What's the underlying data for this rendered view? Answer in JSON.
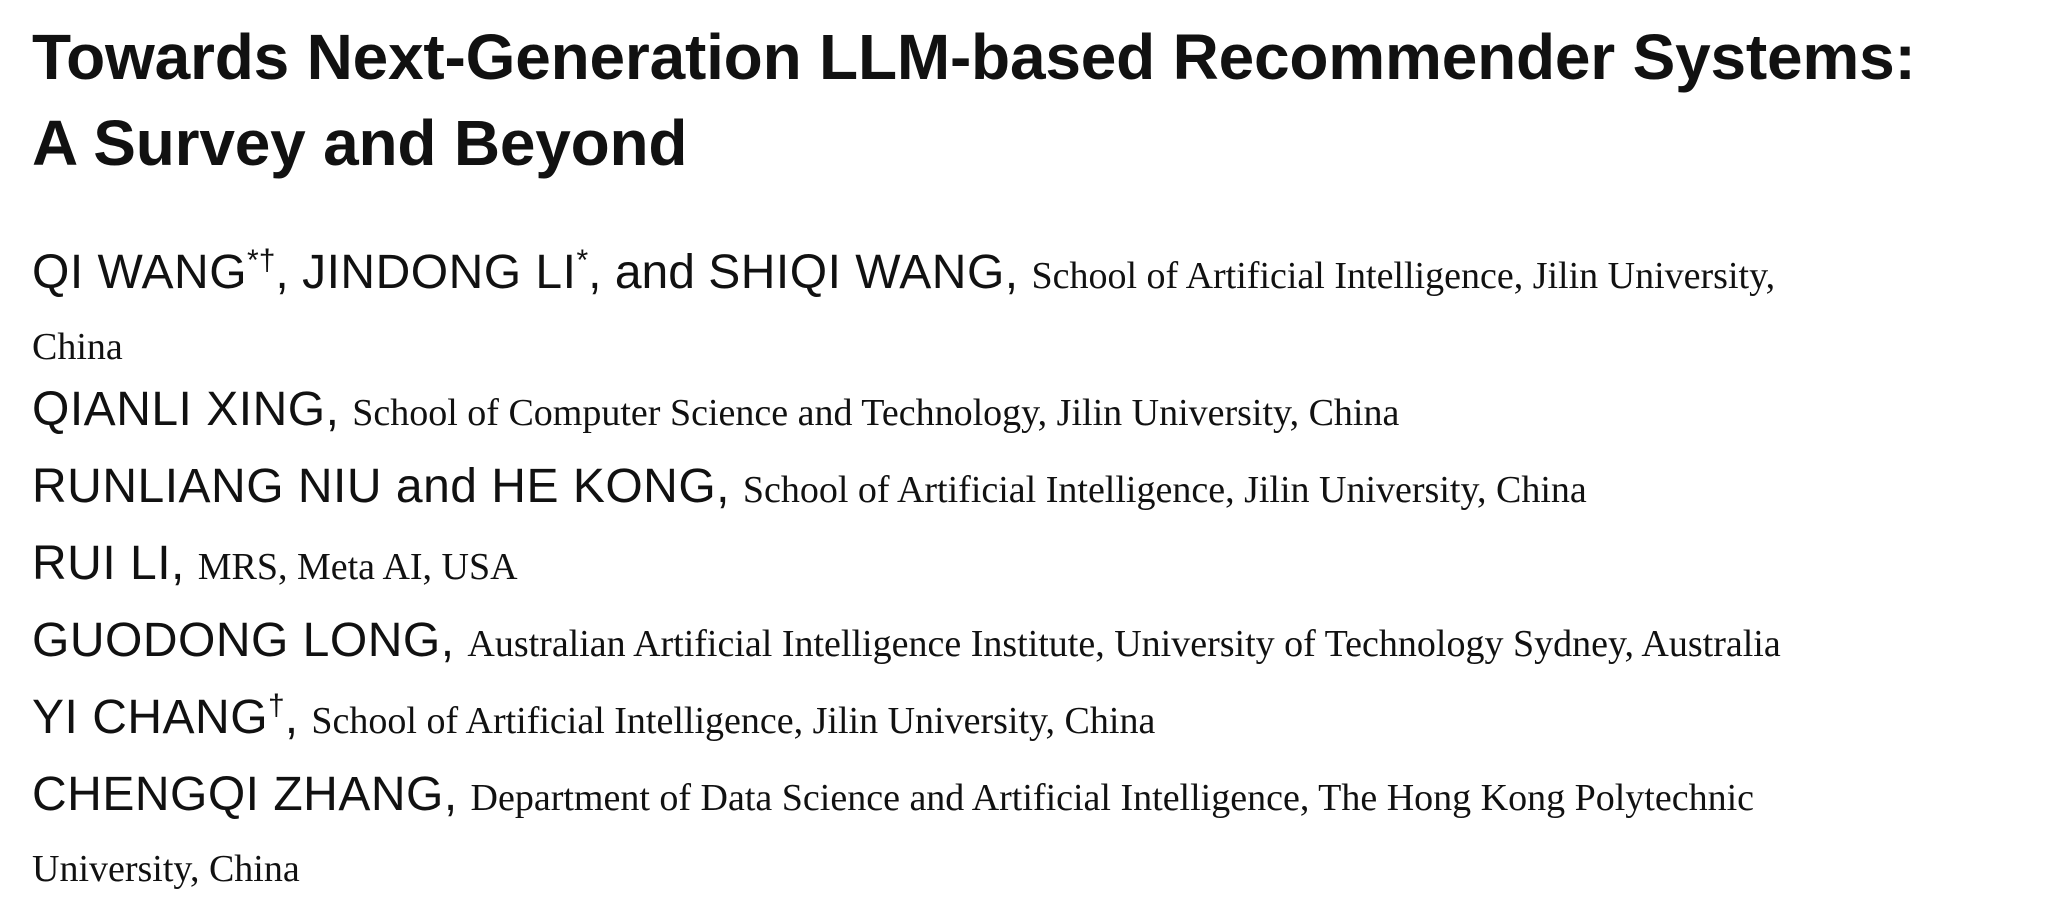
{
  "title": {
    "line1": "Towards Next-Generation LLM-based Recommender Systems:",
    "line2": "A Survey and Beyond"
  },
  "authors": {
    "line1": {
      "name1": "QI WANG",
      "mark1": "*†",
      "sep1": ", ",
      "name2": "JINDONG LI",
      "mark2": "*",
      "sep2": ", and ",
      "name3": "SHIQI WANG",
      "sep3": ", ",
      "affiliation": "School of Artificial Intelligence, Jilin University,",
      "affiliation_cont": "China"
    },
    "line2": {
      "name": "QIANLI XING",
      "sep": ", ",
      "affiliation": "School of Computer Science and Technology, Jilin University, China"
    },
    "line3": {
      "name": "RUNLIANG NIU and HE KONG",
      "sep": ", ",
      "affiliation": "School of Artificial Intelligence, Jilin University, China"
    },
    "line4": {
      "name": "RUI LI",
      "sep": ", ",
      "affiliation": "MRS, Meta AI, USA"
    },
    "line5": {
      "name": "GUODONG LONG",
      "sep": ", ",
      "affiliation": "Australian Artificial Intelligence Institute, University of Technology Sydney, Australia"
    },
    "line6": {
      "name": "YI CHANG",
      "mark": "†",
      "sep": ", ",
      "affiliation": "School of Artificial Intelligence, Jilin University, China"
    },
    "line7": {
      "name": "CHENGQI ZHANG",
      "sep": ", ",
      "affiliation": "Department of Data Science and Artificial Intelligence, The Hong Kong Polytechnic",
      "affiliation_cont": "University, China"
    }
  }
}
